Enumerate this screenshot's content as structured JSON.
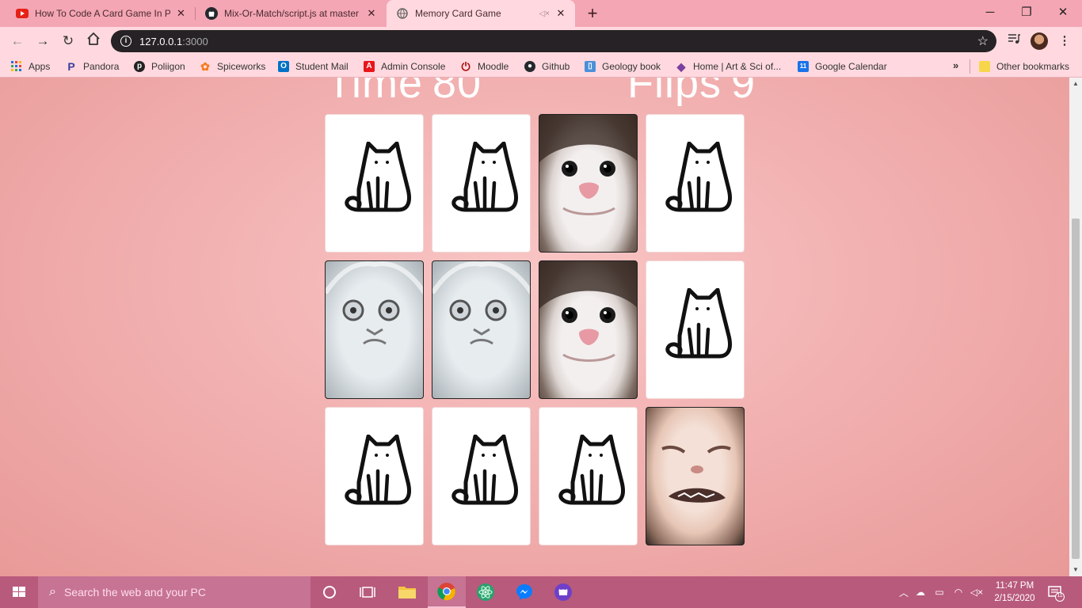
{
  "browser": {
    "tabs": [
      {
        "title": "How To Code A Card Game In Pla",
        "icon": "youtube-icon",
        "active": false
      },
      {
        "title": "Mix-Or-Match/script.js at master",
        "icon": "github-icon",
        "active": false
      },
      {
        "title": "Memory Card Game",
        "icon": "globe-icon",
        "active": true
      }
    ],
    "address": {
      "host": "127.0.0.1",
      "port": ":3000"
    },
    "bookmarks": [
      {
        "label": "Apps",
        "icon": "apps-grid-icon"
      },
      {
        "label": "Pandora",
        "icon": "pandora-icon"
      },
      {
        "label": "Poliigon",
        "icon": "poliigon-icon"
      },
      {
        "label": "Spiceworks",
        "icon": "spiceworks-icon"
      },
      {
        "label": "Student Mail",
        "icon": "outlook-icon"
      },
      {
        "label": "Admin Console",
        "icon": "adobe-icon"
      },
      {
        "label": "Moodle",
        "icon": "moodle-icon"
      },
      {
        "label": "Github",
        "icon": "github-icon"
      },
      {
        "label": "Geology book",
        "icon": "book-icon"
      },
      {
        "label": "Home | Art & Sci of...",
        "icon": "gem-icon"
      },
      {
        "label": "Google Calendar",
        "icon": "calendar-icon",
        "calendar_day": "11"
      }
    ],
    "more_bookmarks": "»",
    "other_bookmarks": "Other bookmarks"
  },
  "game": {
    "time_label": "Time",
    "time_value": "80",
    "flips_label": "Flips",
    "flips_value": "9",
    "cards": [
      {
        "state": "back"
      },
      {
        "state": "back"
      },
      {
        "state": "face",
        "image": "polite-cat"
      },
      {
        "state": "back"
      },
      {
        "state": "face",
        "image": "shocked-white-cat"
      },
      {
        "state": "face",
        "image": "shocked-white-cat"
      },
      {
        "state": "face",
        "image": "polite-cat"
      },
      {
        "state": "back"
      },
      {
        "state": "back"
      },
      {
        "state": "back"
      },
      {
        "state": "back"
      },
      {
        "state": "face",
        "image": "smudge-cat"
      }
    ]
  },
  "taskbar": {
    "search_placeholder": "Search the web and your PC",
    "clock_time": "11:47 PM",
    "clock_date": "2/15/2020",
    "notification_count": "11"
  }
}
